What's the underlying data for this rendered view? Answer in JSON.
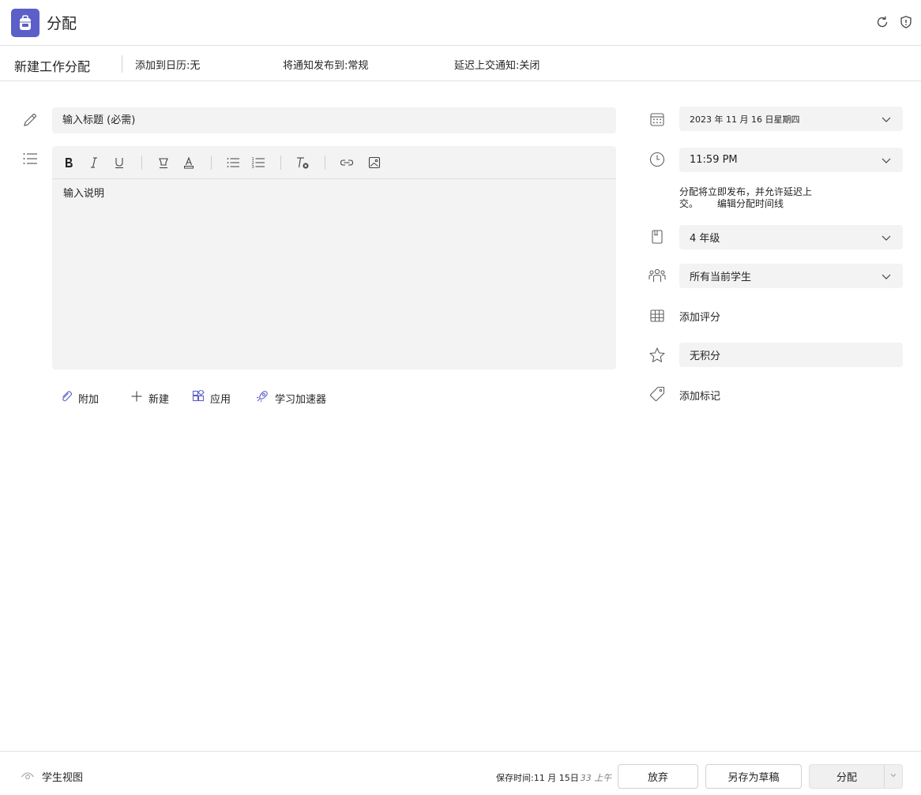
{
  "header": {
    "title": "分配",
    "logo_icon": "backpack-icon",
    "accent_color": "#5b5fc7",
    "icons": [
      "refresh-icon",
      "shield-icon"
    ]
  },
  "subheader": {
    "title": "新建工作分配",
    "calendar_setting": "添加到日历:无",
    "notify_setting": "将通知发布到:常规",
    "late_notify_setting": "延迟上交通知:关闭"
  },
  "form": {
    "title_placeholder": "输入标题 (必需)",
    "description_placeholder": "输入说明",
    "toolbar": [
      "bold-icon",
      "italic-icon",
      "underline-icon",
      "highlight-icon",
      "font-color-icon",
      "bullet-list-icon",
      "numbered-list-icon",
      "clear-format-icon",
      "link-icon",
      "image-icon"
    ],
    "attach_label": "附加",
    "new_label": "新建",
    "apps_label": "应用",
    "accelerator_label": "学习加速器"
  },
  "details": {
    "due_date": "2023 年 11 月 16 日星期四",
    "due_time": "11:59 PM",
    "info_text": "分配将立即发布，并允许延迟上交。",
    "timeline_link": "编辑分配时间线",
    "class": "4 年级",
    "students": "所有当前学生",
    "rubric_label": "添加评分",
    "points": "无积分",
    "tags_label": "添加标记"
  },
  "footer": {
    "student_view": "学生视图",
    "save_time": "保存时间:11 月 15日",
    "save_time_clock": "33 上午",
    "discard": "放弃",
    "save_draft": "另存为草稿",
    "assign": "分配"
  }
}
